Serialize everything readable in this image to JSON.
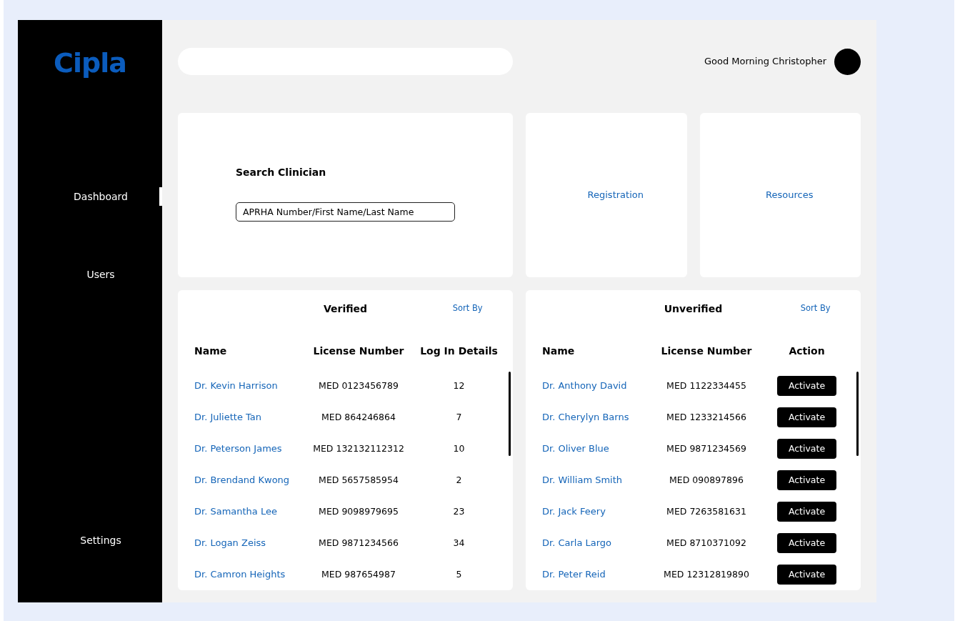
{
  "sidebar": {
    "logo": "Cipla",
    "items": [
      {
        "label": "Dashboard",
        "selected": true
      },
      {
        "label": "Users",
        "selected": false
      },
      {
        "label": "Settings",
        "selected": false
      }
    ]
  },
  "header": {
    "greeting": "Good Morning Christopher"
  },
  "search_card": {
    "title": "Search Clinician",
    "placeholder": "APRHA Number/First Name/Last Name"
  },
  "quick_links": [
    "Registration",
    "Resources"
  ],
  "tables": [
    {
      "title": "Verified",
      "sort_label": "Sort By",
      "kind": "logins",
      "columns": [
        "Name",
        "License Number",
        "Log In Details"
      ],
      "rows": [
        {
          "name": "Dr. Kevin Harrison",
          "license": "MED 0123456789",
          "logins": "12"
        },
        {
          "name": "Dr. Juliette Tan",
          "license": "MED 864246864",
          "logins": "7"
        },
        {
          "name": "Dr. Peterson James",
          "license": "MED 132132112312",
          "logins": "10"
        },
        {
          "name": "Dr. Brendand Kwong",
          "license": "MED 5657585954",
          "logins": "2"
        },
        {
          "name": "Dr. Samantha Lee",
          "license": "MED 9098979695",
          "logins": "23"
        },
        {
          "name": "Dr. Logan Zeiss",
          "license": "MED 9871234566",
          "logins": "34"
        },
        {
          "name": "Dr. Camron Heights",
          "license": "MED 987654987",
          "logins": "5"
        }
      ]
    },
    {
      "title": "Unverified",
      "sort_label": "Sort By",
      "kind": "actions",
      "columns": [
        "Name",
        "License Number",
        "Action"
      ],
      "rows": [
        {
          "name": "Dr. Anthony David",
          "license": "MED 1122334455",
          "action": "Activate"
        },
        {
          "name": "Dr. Cherylyn Barns",
          "license": "MED 1233214566",
          "action": "Activate"
        },
        {
          "name": "Dr. Oliver Blue",
          "license": "MED 9871234569",
          "action": "Activate"
        },
        {
          "name": "Dr. William Smith",
          "license": "MED 090897896",
          "action": "Activate"
        },
        {
          "name": "Dr. Jack Feery",
          "license": "MED 7263581631",
          "action": "Activate"
        },
        {
          "name": "Dr. Carla Largo",
          "license": "MED 8710371092",
          "action": "Activate"
        },
        {
          "name": "Dr. Peter Reid",
          "license": "MED 12312819890",
          "action": "Activate"
        }
      ]
    }
  ]
}
